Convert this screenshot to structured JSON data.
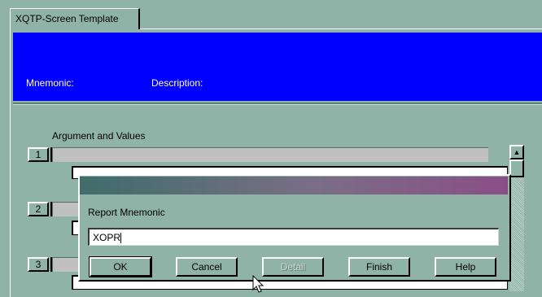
{
  "tab": {
    "label": "XQTP-Screen Template"
  },
  "header": {
    "mnemonic_label": "Mnemonic:",
    "description_label": "Description:",
    "color": "#0000ff"
  },
  "arguments": {
    "title": "Argument and Values",
    "rows": [
      {
        "number": "1"
      },
      {
        "number": "2"
      },
      {
        "number": "3"
      }
    ]
  },
  "scrollbar": {
    "up_arrow_icon": "arrow-up-icon"
  },
  "dialog": {
    "label": "Report Mnemonic",
    "input_value": "XOPR",
    "buttons": {
      "ok": "OK",
      "cancel": "Cancel",
      "detail": "Detail",
      "finish": "Finish",
      "help": "Help"
    }
  },
  "cursor_icon": "mouse-pointer-icon"
}
